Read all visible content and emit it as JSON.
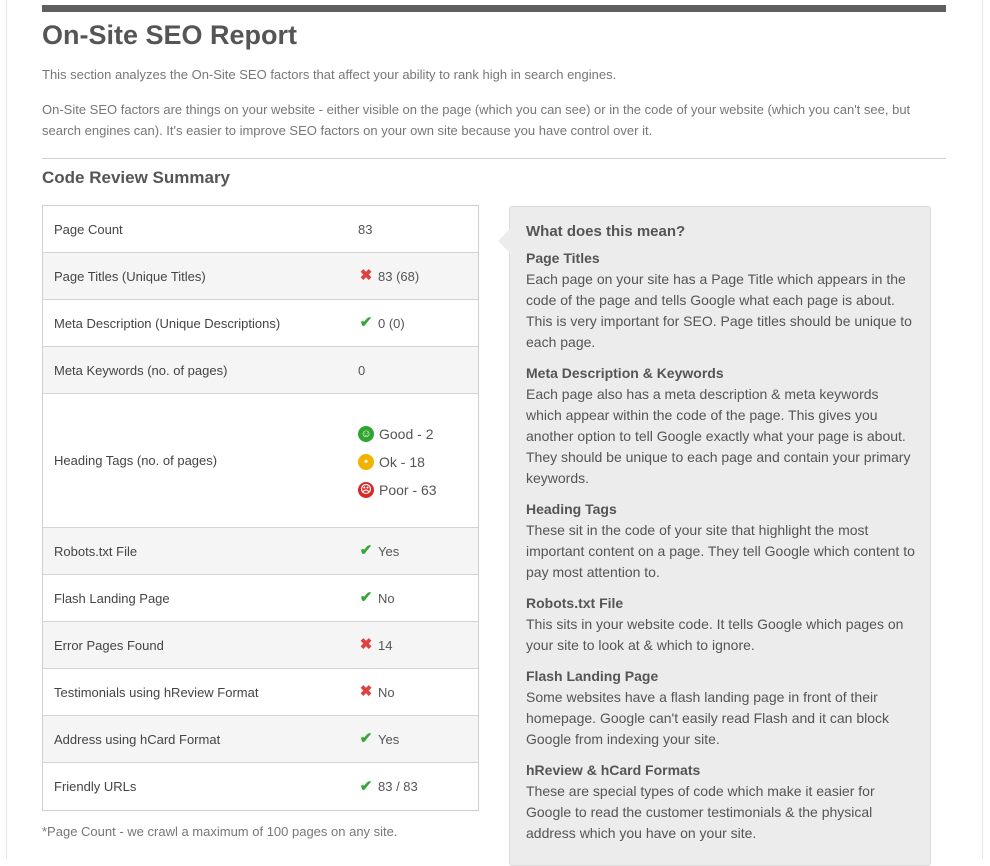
{
  "header": {
    "title": "On-Site SEO Report",
    "intro1": "This section analyzes the On-Site SEO factors that affect your ability to rank high in search engines.",
    "intro2": "On-Site SEO factors are things on your website - either visible on the page (which you can see) or in the code of your website (which you can't see, but search engines can). It's easier to improve SEO factors on your own site because you have control over it."
  },
  "summary": {
    "title": "Code Review Summary",
    "rows": [
      {
        "label": "Page Count",
        "value": "83",
        "status": "none"
      },
      {
        "label": "Page Titles (Unique Titles)",
        "value": "83 (68)",
        "status": "fail"
      },
      {
        "label": "Meta Description (Unique Descriptions)",
        "value": "0 (0)",
        "status": "pass"
      },
      {
        "label": "Meta Keywords (no. of pages)",
        "value": "0",
        "status": "none"
      },
      {
        "label": "Heading Tags (no. of pages)",
        "good": "Good - 2",
        "ok": "Ok - 18",
        "poor": "Poor - 63"
      },
      {
        "label": "Robots.txt File",
        "value": "Yes",
        "status": "pass"
      },
      {
        "label": "Flash Landing Page",
        "value": "No",
        "status": "pass"
      },
      {
        "label": "Error Pages Found",
        "value": "14",
        "status": "fail"
      },
      {
        "label": "Testimonials using hReview Format",
        "value": "No",
        "status": "fail"
      },
      {
        "label": "Address using hCard Format",
        "value": "Yes",
        "status": "pass"
      },
      {
        "label": "Friendly URLs",
        "value": "83 / 83",
        "status": "pass"
      }
    ],
    "footnote": "*Page Count - we crawl a maximum of 100 pages on any site."
  },
  "colors": {
    "pass": "#3aa33a",
    "fail": "#e04040",
    "good": "#2ea52e",
    "ok": "#f2b300",
    "poor": "#d52b2b"
  },
  "explain": {
    "title": "What does this mean?",
    "items": [
      {
        "term": "Page Titles",
        "desc": "Each page on your site has a Page Title which appears in the code of the page and tells Google what each page is about. This is very important for SEO. Page titles should be unique to each page."
      },
      {
        "term": "Meta Description & Keywords",
        "desc": "Each page also has a meta description & meta keywords which appear within the code of the page. This gives you another option to tell Google exactly what your page is about. They should be unique to each page and contain your primary keywords."
      },
      {
        "term": "Heading Tags",
        "desc": "These sit in the code of your site that highlight the most important content on a page. They tell Google which content to pay most attention to."
      },
      {
        "term": "Robots.txt File",
        "desc": "This sits in your website code. It tells Google which pages on your site to look at & which to ignore."
      },
      {
        "term": "Flash Landing Page",
        "desc": "Some websites have a flash landing page in front of their homepage. Google can't easily read Flash and it can block Google from indexing your site."
      },
      {
        "term": "hReview & hCard Formats",
        "desc": "These are special types of code which make it easier for Google to read the customer testimonials & the physical address which you have on your site."
      }
    ]
  }
}
